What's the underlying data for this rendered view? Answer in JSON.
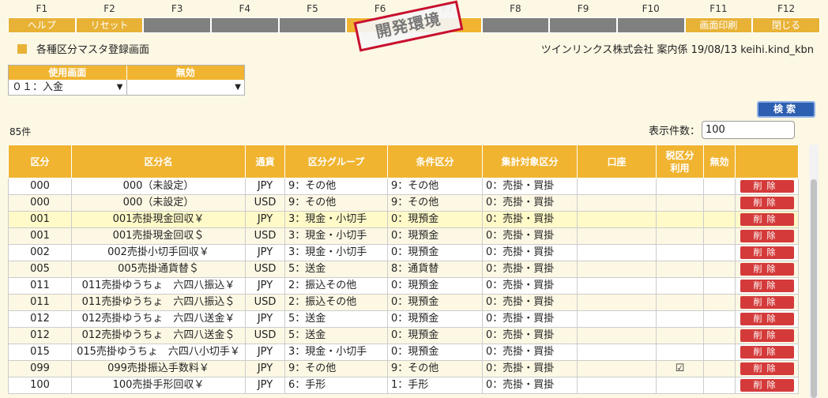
{
  "fkeys": [
    {
      "num": "F1",
      "label": "ヘルプ"
    },
    {
      "num": "F2",
      "label": "リセット"
    },
    {
      "num": "F3",
      "label": ""
    },
    {
      "num": "F4",
      "label": ""
    },
    {
      "num": "F5",
      "label": ""
    },
    {
      "num": "F6",
      "label": ""
    },
    {
      "num": "F7",
      "label": ""
    },
    {
      "num": "F8",
      "label": ""
    },
    {
      "num": "F9",
      "label": ""
    },
    {
      "num": "F10",
      "label": ""
    },
    {
      "num": "F11",
      "label": "画面印刷"
    },
    {
      "num": "F12",
      "label": "閉じる"
    }
  ],
  "stamp": "開発環境",
  "title": "各種区分マスタ登録画面",
  "info": "ツインリンクス株式会社 案内係 19/08/13 keihi.kind_kbn",
  "filter": {
    "h1": "使用画面",
    "h2": "無効",
    "v1": "０１：入金",
    "v2": ""
  },
  "search_label": "検索",
  "count": "85件",
  "perpage_label": "表示件数：",
  "perpage_value": "100",
  "columns": [
    "区分",
    "区分名",
    "通貨",
    "区分グループ",
    "条件区分",
    "集計対象区分",
    "口座",
    "税区分\n利用",
    "無効",
    ""
  ],
  "delete_label": "削除",
  "rows": [
    [
      "000",
      "000（未設定）",
      "JPY",
      "9：その他",
      "9：その他",
      "0：売掛・買掛",
      "",
      "",
      ""
    ],
    [
      "000",
      "000（未設定）",
      "USD",
      "9：その他",
      "9：その他",
      "0：売掛・買掛",
      "",
      "",
      ""
    ],
    [
      "001",
      "001売掛現金回収￥",
      "JPY",
      "3：現金・小切手",
      "0：現預金",
      "0：売掛・買掛",
      "",
      "",
      ""
    ],
    [
      "001",
      "001売掛現金回収＄",
      "USD",
      "3：現金・小切手",
      "0：現預金",
      "0：売掛・買掛",
      "",
      "",
      ""
    ],
    [
      "002",
      "002売掛小切手回収￥",
      "JPY",
      "3：現金・小切手",
      "0：現預金",
      "0：売掛・買掛",
      "",
      "",
      ""
    ],
    [
      "005",
      "005売掛通貨替＄",
      "USD",
      "5：送金",
      "8：通貨替",
      "0：売掛・買掛",
      "",
      "",
      ""
    ],
    [
      "011",
      "011売掛ゆうちょ　六四八振込￥",
      "JPY",
      "2：振込その他",
      "0：現預金",
      "0：売掛・買掛",
      "",
      "",
      ""
    ],
    [
      "011",
      "011売掛ゆうちょ　六四八振込＄",
      "USD",
      "2：振込その他",
      "0：現預金",
      "0：売掛・買掛",
      "",
      "",
      ""
    ],
    [
      "012",
      "012売掛ゆうちょ　六四八送金￥",
      "JPY",
      "5：送金",
      "0：現預金",
      "0：売掛・買掛",
      "",
      "",
      ""
    ],
    [
      "012",
      "012売掛ゆうちょ　六四八送金＄",
      "USD",
      "5：送金",
      "0：現預金",
      "0：売掛・買掛",
      "",
      "",
      ""
    ],
    [
      "015",
      "015売掛ゆうちょ　六四八小切手￥",
      "JPY",
      "3：現金・小切手",
      "0：現預金",
      "0：売掛・買掛",
      "",
      "",
      ""
    ],
    [
      "099",
      "099売掛振込手数料￥",
      "JPY",
      "9：その他",
      "9：その他",
      "0：売掛・買掛",
      "",
      "☑",
      ""
    ],
    [
      "100",
      "100売掛手形回収￥",
      "JPY",
      "6：手形",
      "1：手形",
      "0：売掛・買掛",
      "",
      "",
      ""
    ]
  ]
}
